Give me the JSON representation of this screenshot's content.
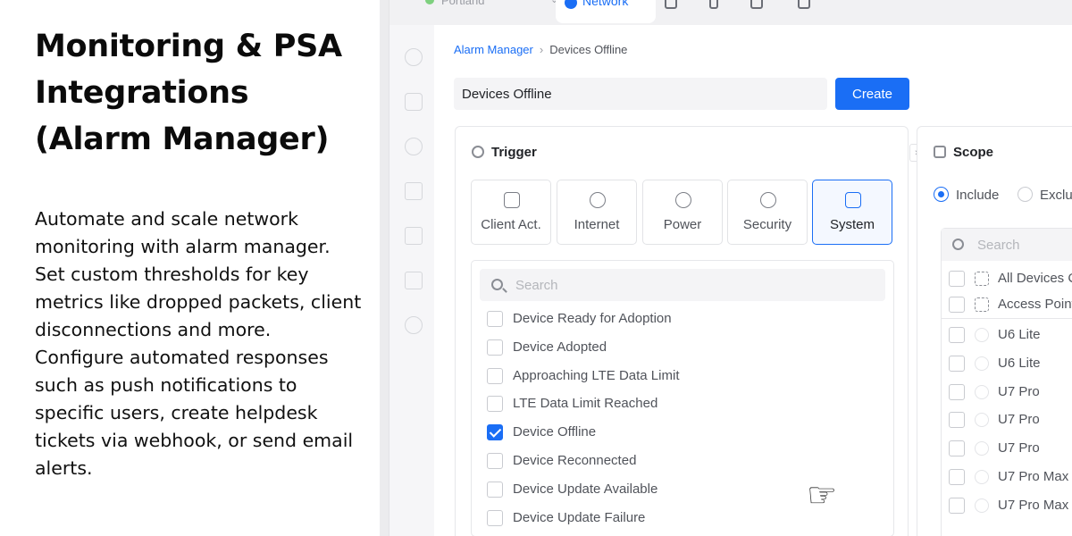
{
  "left_panel": {
    "heading": "Monitoring & PSA Integrations (Alarm Manager)",
    "body": "Automate and scale network monitoring with alarm manager. Set custom thresholds for key metrics like dropped packets, client disconnections and more. Configure automated responses such as push notifications to specific users, create helpdesk tickets via webhook, or send email alerts."
  },
  "topbar": {
    "site_name": "Portland",
    "active_tab": "Network"
  },
  "breadcrumb": {
    "parent": "Alarm Manager",
    "current": "Devices Offline"
  },
  "alarm_form": {
    "name_value": "Devices Offline",
    "create_label": "Create"
  },
  "trigger": {
    "title": "Trigger",
    "tabs": [
      {
        "label": "Client Act.",
        "icon": "client-activity-icon"
      },
      {
        "label": "Internet",
        "icon": "globe-icon"
      },
      {
        "label": "Power",
        "icon": "power-icon"
      },
      {
        "label": "Security",
        "icon": "shield-icon"
      },
      {
        "label": "System",
        "icon": "system-icon"
      }
    ],
    "selected_tab": "System",
    "search_placeholder": "Search",
    "items": [
      {
        "label": "Device Ready for Adoption",
        "checked": false
      },
      {
        "label": "Device Adopted",
        "checked": false
      },
      {
        "label": "Approaching LTE Data Limit",
        "checked": false
      },
      {
        "label": "LTE Data Limit Reached",
        "checked": false
      },
      {
        "label": "Device Offline",
        "checked": true
      },
      {
        "label": "Device Reconnected",
        "checked": false
      },
      {
        "label": "Device Update Available",
        "checked": false
      },
      {
        "label": "Device Update Failure",
        "checked": false
      }
    ]
  },
  "scope": {
    "title": "Scope",
    "include_label": "Include",
    "exclude_label": "Exclu",
    "search_placeholder": "Search",
    "groups": [
      {
        "label": "All Devices C"
      },
      {
        "label": "Access Point"
      }
    ],
    "devices": [
      {
        "label": "U6 Lite"
      },
      {
        "label": "U6 Lite"
      },
      {
        "label": "U7 Pro"
      },
      {
        "label": "U7 Pro"
      },
      {
        "label": "U7 Pro"
      },
      {
        "label": "U7 Pro Max"
      },
      {
        "label": "U7 Pro Max"
      }
    ]
  },
  "colors": {
    "accent": "#1a6ef5",
    "text": "#212327",
    "muted": "#50535a"
  }
}
